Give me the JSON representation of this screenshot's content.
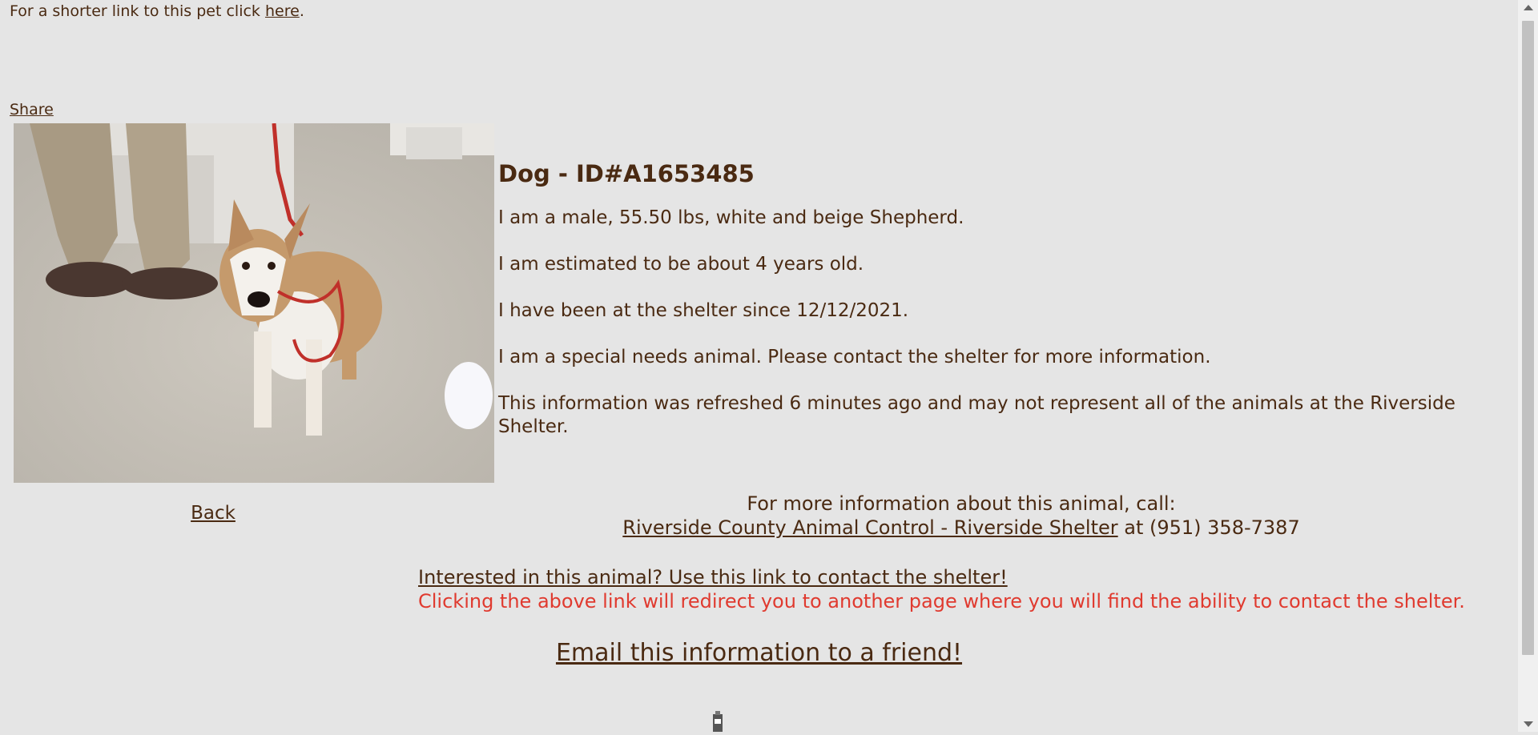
{
  "top": {
    "prefix": "For a shorter link to this pet click ",
    "link": "here",
    "suffix": "."
  },
  "share_label": "Share",
  "photo": {
    "alt": "Photo of a white and beige Shepherd dog on a red leash"
  },
  "info": {
    "title": "Dog - ID#A1653485",
    "line1": "I am a male, 55.50 lbs, white and beige Shepherd.",
    "line2": "I am estimated to be about 4 years old.",
    "line3": "I have been at the shelter since 12/12/2021.",
    "line4": "I am a special needs animal. Please contact the shelter for more information.",
    "line5": "This information was refreshed 6 minutes ago and may not represent all of the animals at the Riverside Shelter."
  },
  "back_label": "Back",
  "contact": {
    "intro": "For more information about this animal, call:",
    "shelter_link": "Riverside County Animal Control - Riverside Shelter",
    "phone": " at (951) 358-7387"
  },
  "interest": {
    "link": "Interested in this animal? Use this link to contact the shelter!",
    "note": "Clicking the above link will redirect you to another page where you will find the ability to contact the shelter."
  },
  "email_label": "Email this information to a friend!",
  "colors": {
    "background": "#e5e5e5",
    "text": "#4a2a12",
    "alert": "#e03a2f"
  }
}
